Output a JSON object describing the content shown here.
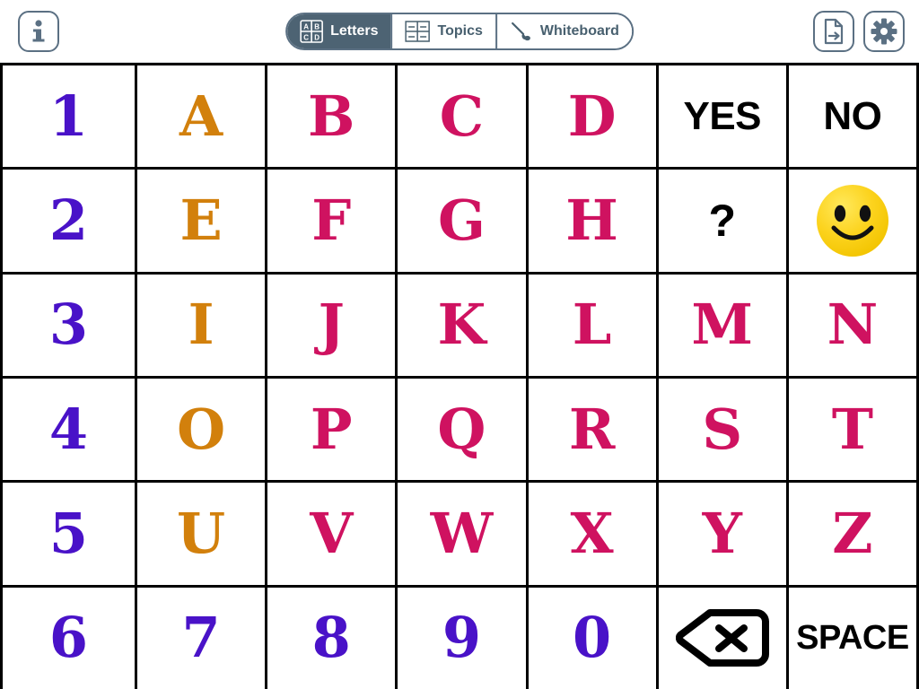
{
  "toolbar": {
    "info_button": {
      "name": "Info",
      "icon": "info-icon"
    },
    "tabs": [
      {
        "id": "letters",
        "label": "Letters",
        "icon": "abcd-grid-icon",
        "active": true
      },
      {
        "id": "topics",
        "label": "Topics",
        "icon": "topics-grid-icon",
        "active": false
      },
      {
        "id": "whiteboard",
        "label": "Whiteboard",
        "icon": "paintbrush-icon",
        "active": false
      }
    ],
    "export_button": {
      "name": "Export",
      "icon": "document-export-icon"
    },
    "settings_button": {
      "name": "Settings",
      "icon": "gear-icon"
    },
    "letters_icon_cells": [
      "A",
      "B",
      "C",
      "D"
    ]
  },
  "colors": {
    "number": "#4912c8",
    "vowel": "#d2800c",
    "consonant": "#cf1260",
    "word": "#000000",
    "toolbar_accent": "#4d6373",
    "toolbar_outline": "#5b7083",
    "grid_border": "#000000",
    "cell_background": "#ffffff",
    "smiley_yellow": "#fcd928"
  },
  "board": {
    "columns": 7,
    "rows": 6,
    "cells": [
      {
        "text": "1",
        "kind": "number"
      },
      {
        "text": "A",
        "kind": "vowel"
      },
      {
        "text": "B",
        "kind": "consonant"
      },
      {
        "text": "C",
        "kind": "consonant"
      },
      {
        "text": "D",
        "kind": "consonant"
      },
      {
        "text": "YES",
        "kind": "word"
      },
      {
        "text": "NO",
        "kind": "word"
      },
      {
        "text": "2",
        "kind": "number"
      },
      {
        "text": "E",
        "kind": "vowel"
      },
      {
        "text": "F",
        "kind": "consonant"
      },
      {
        "text": "G",
        "kind": "consonant"
      },
      {
        "text": "H",
        "kind": "consonant"
      },
      {
        "text": "?",
        "kind": "question"
      },
      {
        "text": "",
        "kind": "smiley",
        "icon": "smiley-face-icon"
      },
      {
        "text": "3",
        "kind": "number"
      },
      {
        "text": "I",
        "kind": "vowel"
      },
      {
        "text": "J",
        "kind": "consonant"
      },
      {
        "text": "K",
        "kind": "consonant"
      },
      {
        "text": "L",
        "kind": "consonant"
      },
      {
        "text": "M",
        "kind": "consonant"
      },
      {
        "text": "N",
        "kind": "consonant"
      },
      {
        "text": "4",
        "kind": "number"
      },
      {
        "text": "O",
        "kind": "vowel"
      },
      {
        "text": "P",
        "kind": "consonant"
      },
      {
        "text": "Q",
        "kind": "consonant"
      },
      {
        "text": "R",
        "kind": "consonant"
      },
      {
        "text": "S",
        "kind": "consonant"
      },
      {
        "text": "T",
        "kind": "consonant"
      },
      {
        "text": "5",
        "kind": "number"
      },
      {
        "text": "U",
        "kind": "vowel"
      },
      {
        "text": "V",
        "kind": "consonant"
      },
      {
        "text": "W",
        "kind": "consonant"
      },
      {
        "text": "X",
        "kind": "consonant"
      },
      {
        "text": "Y",
        "kind": "consonant"
      },
      {
        "text": "Z",
        "kind": "consonant"
      },
      {
        "text": "6",
        "kind": "number"
      },
      {
        "text": "7",
        "kind": "number"
      },
      {
        "text": "8",
        "kind": "number"
      },
      {
        "text": "9",
        "kind": "number"
      },
      {
        "text": "0",
        "kind": "number"
      },
      {
        "text": "",
        "kind": "backspace",
        "icon": "backspace-icon"
      },
      {
        "text": "SPACE",
        "kind": "word-small"
      }
    ]
  }
}
